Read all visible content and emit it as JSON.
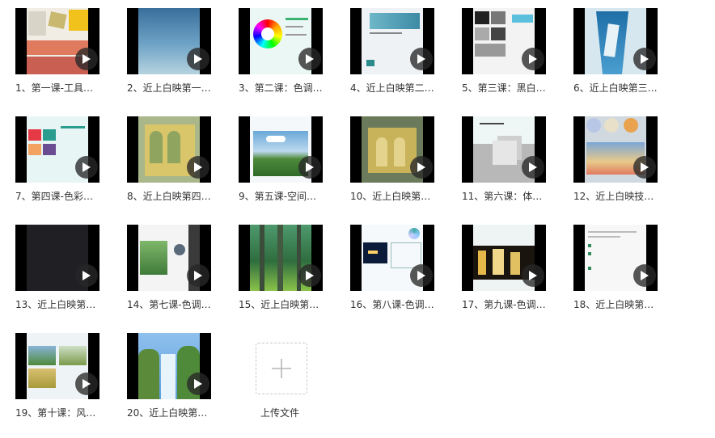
{
  "files": [
    {
      "label": "1、第一课-工具…",
      "thumb": "tools-collage"
    },
    {
      "label": "2、近上白映第一…",
      "thumb": "blue-gradient"
    },
    {
      "label": "3、第二课：色调…",
      "thumb": "color-wheel"
    },
    {
      "label": "4、近上白映第二…",
      "thumb": "software-ui"
    },
    {
      "label": "5、第三课：黑白…",
      "thumb": "grayscale-slides"
    },
    {
      "label": "6、近上白映第三…",
      "thumb": "blue-painting"
    },
    {
      "label": "7、第四课-色彩…",
      "thumb": "color-swatches"
    },
    {
      "label": "8、近上白映第四…",
      "thumb": "arch-painting"
    },
    {
      "label": "9、第五课-空间…",
      "thumb": "landscape-sky"
    },
    {
      "label": "10、近上白映第…",
      "thumb": "yellow-arches"
    },
    {
      "label": "11、第六课：体…",
      "thumb": "cube-render"
    },
    {
      "label": "12、近上白映技…",
      "thumb": "paint-jars"
    },
    {
      "label": "13、近上白映第…",
      "thumb": "dark-screen"
    },
    {
      "label": "14、第七课-色调…",
      "thumb": "ps-forest"
    },
    {
      "label": "15、近上白映第…",
      "thumb": "green-forest"
    },
    {
      "label": "16、第八课-色调…",
      "thumb": "night-sketch"
    },
    {
      "label": "17、第九课-色调…",
      "thumb": "lamp-photos"
    },
    {
      "label": "18、近上白映第…",
      "thumb": "text-doc"
    },
    {
      "label": "19、第十课：风…",
      "thumb": "landscape-grid"
    },
    {
      "label": "20、近上白映第…",
      "thumb": "waterfall"
    }
  ],
  "upload": {
    "label": "上传文件"
  },
  "play_icon": "play-icon",
  "colors": {
    "tile_bg": "#000000",
    "play_bg": "#282828",
    "text": "#333333"
  }
}
